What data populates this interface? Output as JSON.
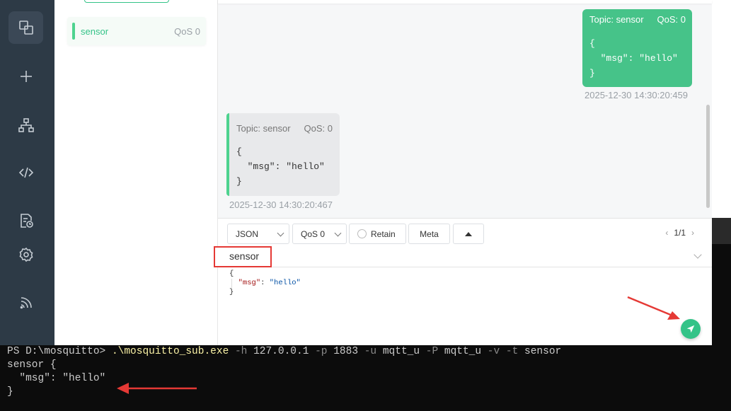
{
  "rail": {
    "icons": [
      "connections-icon",
      "add-icon",
      "topology-icon",
      "script-icon",
      "log-icon",
      "settings-icon",
      "feed-icon"
    ]
  },
  "subscriptions": {
    "items": [
      {
        "topic": "sensor",
        "qos": "QoS 0"
      }
    ]
  },
  "messages": [
    {
      "direction": "out",
      "topic_label": "Topic: sensor",
      "qos_label": "QoS: 0",
      "lines": [
        "{",
        "  \"msg\": \"hello\"",
        "}"
      ],
      "timestamp": "2025-12-30 14:30:20:459"
    },
    {
      "direction": "in",
      "topic_label": "Topic: sensor",
      "qos_label": "QoS: 0",
      "lines": [
        "{",
        "  \"msg\": \"hello\"",
        "}"
      ],
      "timestamp": "2025-12-30 14:30:20:467"
    }
  ],
  "composer": {
    "format": "JSON",
    "qos": "QoS 0",
    "retain_label": "Retain",
    "meta_label": "Meta",
    "pager": "1/1",
    "topic": "sensor",
    "payload": {
      "open": "{",
      "key": "\"msg\"",
      "sep": ": ",
      "value": "\"hello\"",
      "close": "}"
    }
  },
  "terminal": {
    "prompt": "PS D:\\mosquitto> ",
    "cmd": ".\\mosquitto_sub.exe",
    "args": [
      {
        "flag": "-h",
        "val": "127.0.0.1"
      },
      {
        "flag": "-p",
        "val": "1883"
      },
      {
        "flag": "-u",
        "val": "mqtt_u"
      },
      {
        "flag": "-P",
        "val": "mqtt_u"
      },
      {
        "flag": "-v",
        "val": ""
      },
      {
        "flag": "-t",
        "val": "sensor"
      }
    ],
    "output": [
      "sensor {",
      "  \"msg\": \"hello\"",
      "}"
    ]
  },
  "colors": {
    "accent": "#34c388",
    "annotation": "#e53935"
  }
}
